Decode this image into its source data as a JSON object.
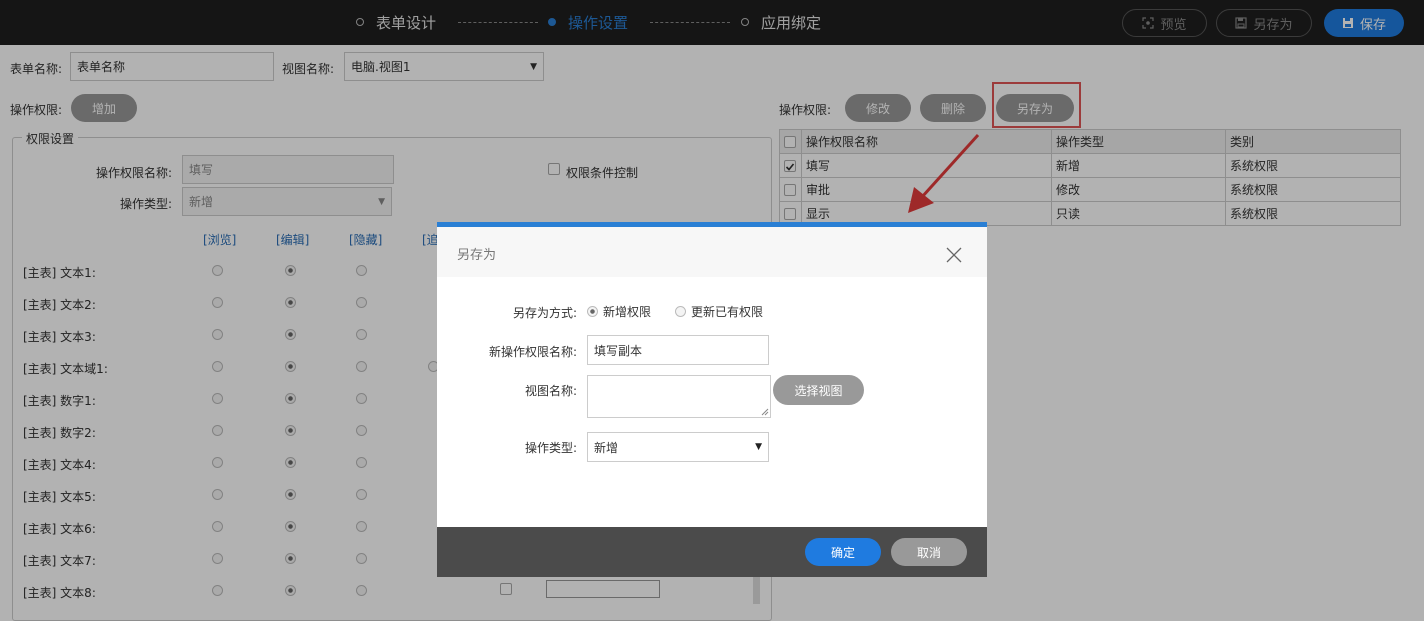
{
  "topbar": {
    "steps": [
      {
        "label": "表单设计",
        "active": false
      },
      {
        "label": "操作设置",
        "active": true
      },
      {
        "label": "应用绑定",
        "active": false
      }
    ],
    "preview_label": "预览",
    "save_as_label": "另存为",
    "save_label": "保存",
    "accent_color": "#1f7be0"
  },
  "form": {
    "form_name_label": "表单名称:",
    "form_name_value": "表单名称",
    "view_name_label": "视图名称:",
    "view_name_value": "电脑.视图1",
    "perm_label": "操作权限:",
    "add_label": "增加"
  },
  "perm_settings": {
    "legend": "权限设置",
    "name_label": "操作权限名称:",
    "name_value": "填写",
    "condition_label": "权限条件控制",
    "type_label": "操作类型:",
    "type_value": "新增",
    "col_links": [
      "[浏览]",
      "[编辑]",
      "[隐藏]",
      "[追"
    ],
    "fields": [
      {
        "label": "[主表] 文本1:",
        "selected": 1
      },
      {
        "label": "[主表] 文本2:",
        "selected": 1
      },
      {
        "label": "[主表] 文本3:",
        "selected": 1
      },
      {
        "label": "[主表] 文本域1:",
        "selected": 1
      },
      {
        "label": "[主表] 数字1:",
        "selected": 1
      },
      {
        "label": "[主表] 数字2:",
        "selected": 1
      },
      {
        "label": "[主表] 文本4:",
        "selected": 1
      },
      {
        "label": "[主表] 文本5:",
        "selected": 1
      },
      {
        "label": "[主表] 文本6:",
        "selected": 1
      },
      {
        "label": "[主表] 文本7:",
        "selected": 1
      },
      {
        "label": "[主表] 文本8:",
        "selected": 1
      }
    ]
  },
  "right_panel": {
    "perm_label": "操作权限:",
    "modify_label": "修改",
    "delete_label": "删除",
    "save_as_label": "另存为",
    "table": {
      "headers": [
        "操作权限名称",
        "操作类型",
        "类别"
      ],
      "rows": [
        {
          "checked": true,
          "cells": [
            "填写",
            "新增",
            "系统权限"
          ]
        },
        {
          "checked": false,
          "cells": [
            "审批",
            "修改",
            "系统权限"
          ]
        },
        {
          "checked": false,
          "cells": [
            "显示",
            "只读",
            "系统权限"
          ]
        }
      ]
    },
    "highlight_color": "#e05555"
  },
  "dialog": {
    "title": "另存为",
    "mode_label": "另存为方式:",
    "mode_options": [
      "新增权限",
      "更新已有权限"
    ],
    "mode_selected": 0,
    "new_name_label": "新操作权限名称:",
    "new_name_value": "填写副本",
    "view_name_label": "视图名称:",
    "view_name_value": "",
    "select_view_label": "选择视图",
    "op_type_label": "操作类型:",
    "op_type_value": "新增",
    "confirm_label": "确定",
    "cancel_label": "取消"
  }
}
